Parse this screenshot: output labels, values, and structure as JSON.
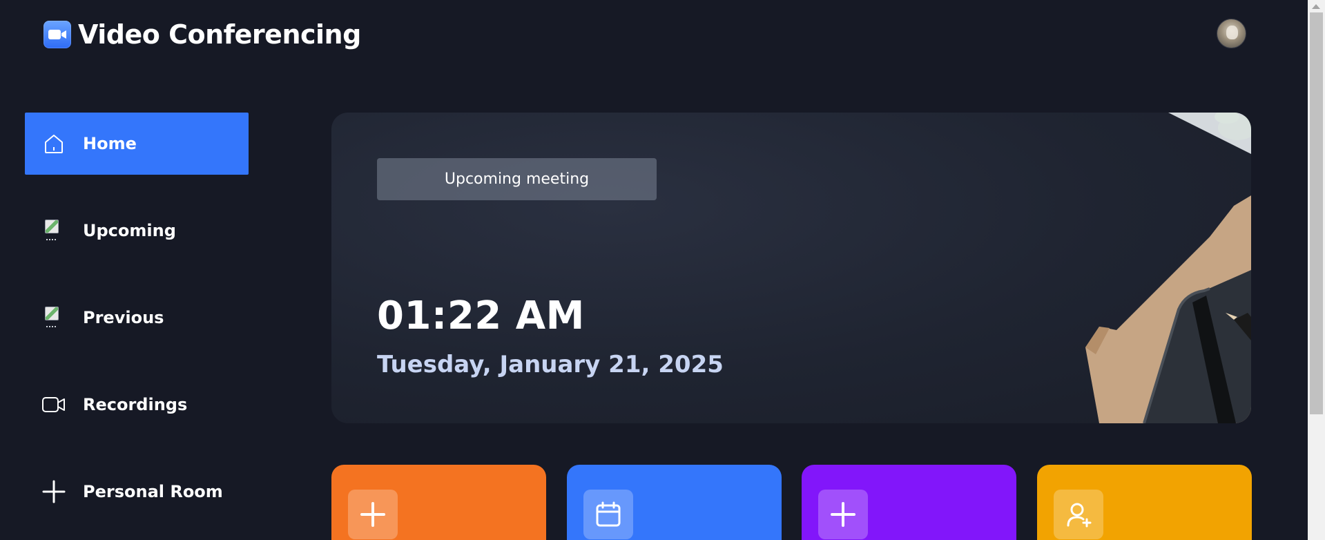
{
  "app": {
    "title": "Video Conferencing",
    "logo_icon": "video-camera-icon",
    "avatar_icon": "user-avatar"
  },
  "sidebar": {
    "items": [
      {
        "label": "Home",
        "icon": "home-icon",
        "active": true
      },
      {
        "label": "Upcoming",
        "icon": "broken-image-icon",
        "active": false
      },
      {
        "label": "Previous",
        "icon": "broken-image-icon",
        "active": false
      },
      {
        "label": "Recordings",
        "icon": "video-icon",
        "active": false
      },
      {
        "label": "Personal Room",
        "icon": "plus-icon",
        "active": false
      }
    ]
  },
  "hero": {
    "badge": "Upcoming meeting",
    "time": "01:22 AM",
    "date": "Tuesday, January 21, 2025"
  },
  "cards": [
    {
      "icon": "plus-icon",
      "color": "#f47321"
    },
    {
      "icon": "calendar-icon",
      "color": "#3476fb"
    },
    {
      "icon": "plus-icon",
      "color": "#8216fa"
    },
    {
      "icon": "user-plus-icon",
      "color": "#f2a301"
    }
  ],
  "colors": {
    "background": "#161925",
    "accent": "#3476fb",
    "hero_bg": "#1f2431"
  }
}
